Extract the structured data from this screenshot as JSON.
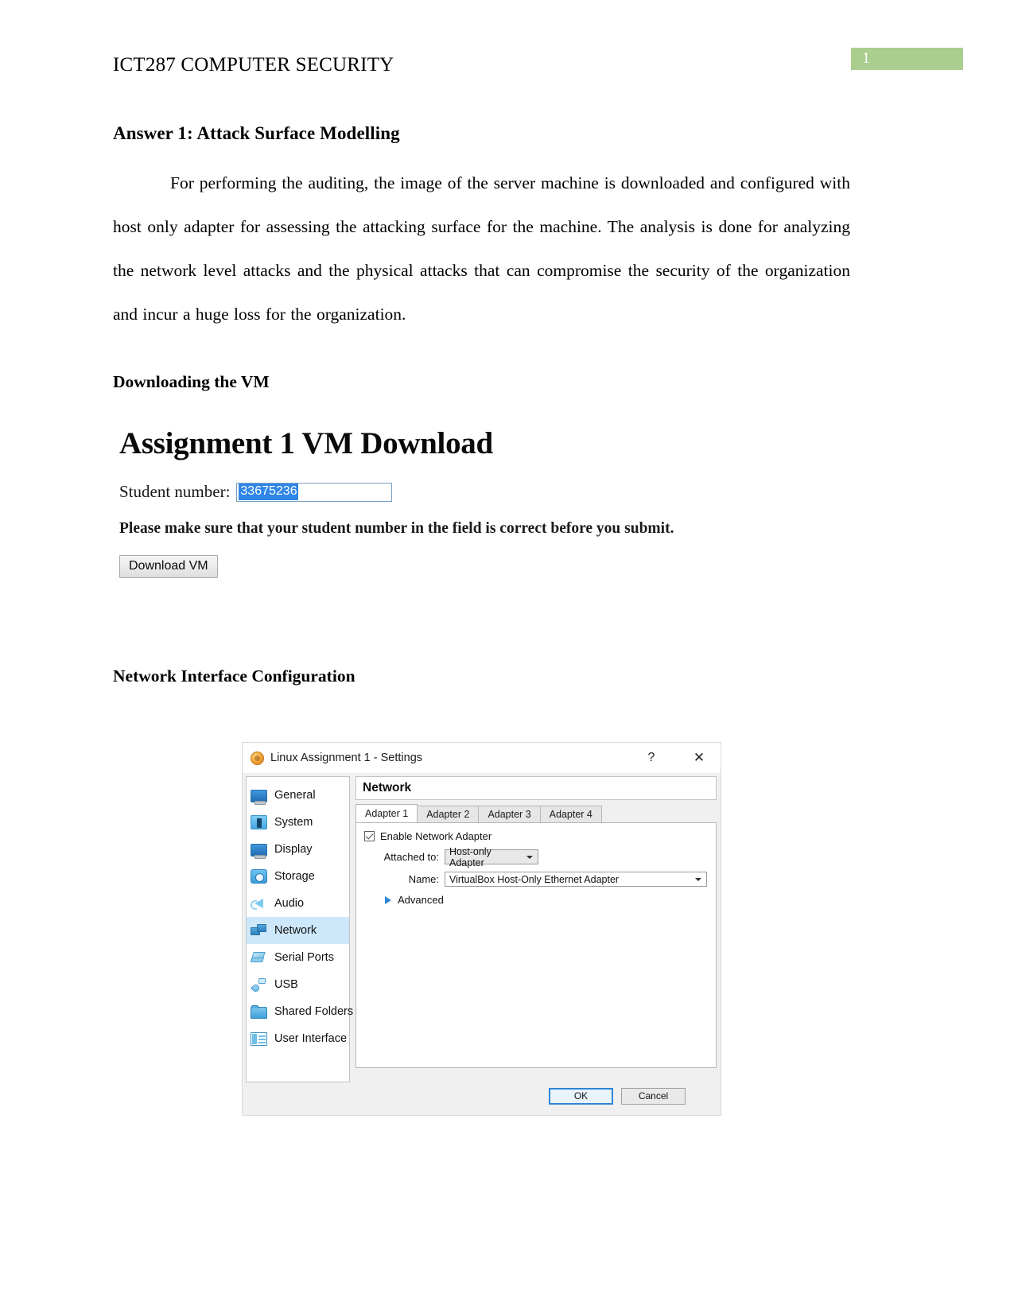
{
  "header": {
    "doc_title": "ICT287 COMPUTER SECURITY",
    "page_number": "1",
    "page_number_bg": "#A9CE8E"
  },
  "document": {
    "section_heading": "Answer 1: Attack Surface Modelling",
    "paragraph": "For performing the auditing, the image of the server machine is downloaded and configured with host only adapter for assessing the attacking surface for the machine. The analysis is done for analyzing the network level attacks and the physical attacks that can compromise the security of the organization and incur a huge loss for the organization.",
    "sub_heading_1": "Downloading the VM",
    "sub_heading_2": "Network Interface Configuration"
  },
  "vm_download_page": {
    "title": "Assignment 1 VM Download",
    "student_label": "Student number:",
    "student_number_value": "33675236",
    "note": "Please make sure that your student number in the field is correct before you submit.",
    "download_button": "Download VM",
    "selection_color": "#2f86e8"
  },
  "vbox_dialog": {
    "title": "Linux Assignment 1 - Settings",
    "help_glyph": "?",
    "close_glyph": "✕",
    "sidebar": [
      {
        "label": "General",
        "icon": "monitor-icon",
        "selected": false
      },
      {
        "label": "System",
        "icon": "chip-icon",
        "selected": false
      },
      {
        "label": "Display",
        "icon": "monitor-icon",
        "selected": false
      },
      {
        "label": "Storage",
        "icon": "disk-icon",
        "selected": false
      },
      {
        "label": "Audio",
        "icon": "speaker-icon",
        "selected": false
      },
      {
        "label": "Network",
        "icon": "network-icon",
        "selected": true
      },
      {
        "label": "Serial Ports",
        "icon": "serial-port-icon",
        "selected": false
      },
      {
        "label": "USB",
        "icon": "usb-icon",
        "selected": false
      },
      {
        "label": "Shared Folders",
        "icon": "folder-icon",
        "selected": false
      },
      {
        "label": "User Interface",
        "icon": "user-interface-icon",
        "selected": false
      }
    ],
    "pane_title": "Network",
    "tabs": [
      {
        "label": "Adapter 1",
        "active": true
      },
      {
        "label": "Adapter 2",
        "active": false
      },
      {
        "label": "Adapter 3",
        "active": false
      },
      {
        "label": "Adapter 4",
        "active": false
      }
    ],
    "enable_adapter_label": "Enable Network Adapter",
    "enable_adapter_checked": true,
    "attached_to_label": "Attached to:",
    "attached_to_value": "Host-only Adapter",
    "name_label": "Name:",
    "name_value": "VirtualBox Host-Only Ethernet Adapter",
    "advanced_label": "Advanced",
    "ok_button": "OK",
    "cancel_button": "Cancel",
    "selected_item_color": "#cde8fa"
  }
}
